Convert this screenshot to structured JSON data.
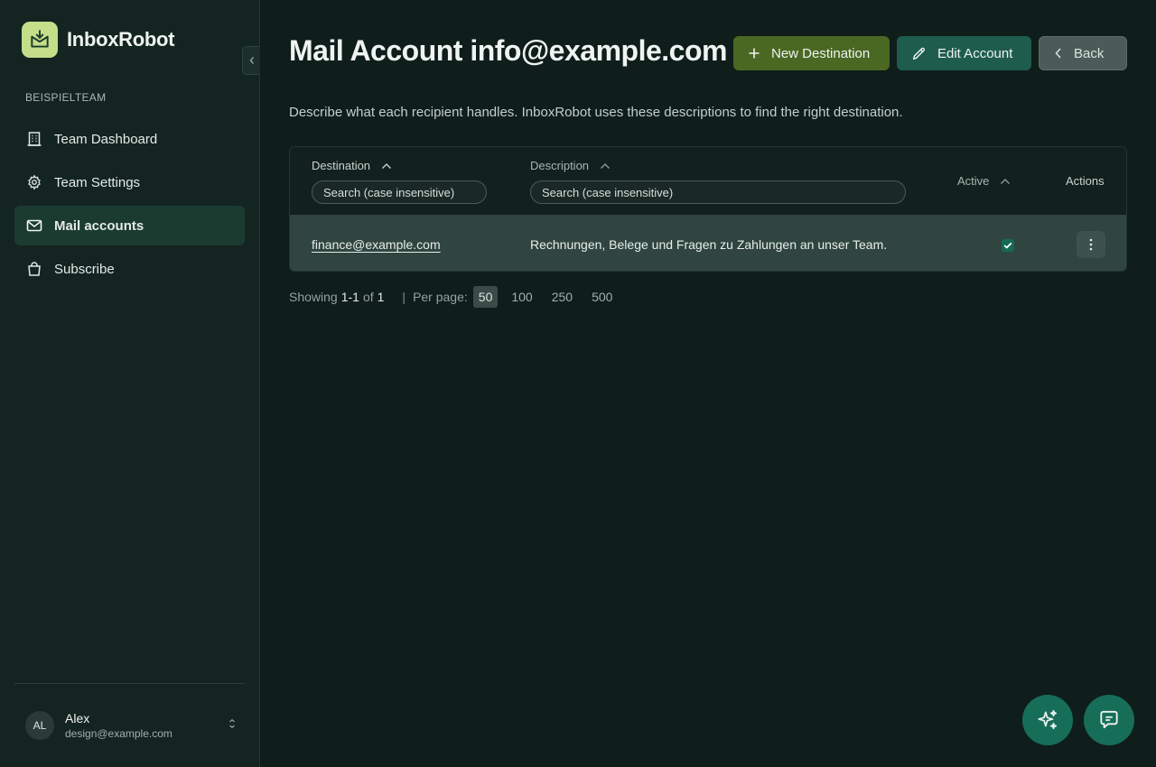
{
  "app": {
    "name": "InboxRobot"
  },
  "sidebar": {
    "team_label": "BEISPIELTEAM",
    "items": [
      {
        "label": "Team Dashboard",
        "icon": "building-icon"
      },
      {
        "label": "Team Settings",
        "icon": "gear-icon"
      },
      {
        "label": "Mail accounts",
        "icon": "mail-icon",
        "active": true
      },
      {
        "label": "Subscribe",
        "icon": "shopping-bag-icon"
      }
    ],
    "user": {
      "initials": "AL",
      "name": "Alex",
      "email": "design@example.com"
    }
  },
  "header": {
    "title": "Mail Account info@example.com",
    "new_destination_label": "New Destination",
    "edit_account_label": "Edit Account",
    "back_label": "Back"
  },
  "description": "Describe what each recipient handles. InboxRobot uses these descriptions to find the right destination.",
  "table": {
    "columns": {
      "destination": "Destination",
      "description": "Description",
      "active": "Active",
      "actions": "Actions"
    },
    "search_placeholder": "Search (case insensitive)",
    "rows": [
      {
        "destination": "finance@example.com",
        "description": "Rechnungen, Belege und Fragen zu Zahlungen an unser Team.",
        "active": true
      }
    ]
  },
  "pagination": {
    "showing_label": "Showing",
    "range": "1-1",
    "of_label": "of",
    "total": "1",
    "per_page_label": "Per page:",
    "options": [
      "50",
      "100",
      "250",
      "500"
    ],
    "selected": "50"
  },
  "colors": {
    "background": "#0f1d1b",
    "sidebar": "#142421",
    "accent_green": "#4a6822",
    "accent_teal": "#1e5c4e",
    "logo": "#c4de8a"
  }
}
